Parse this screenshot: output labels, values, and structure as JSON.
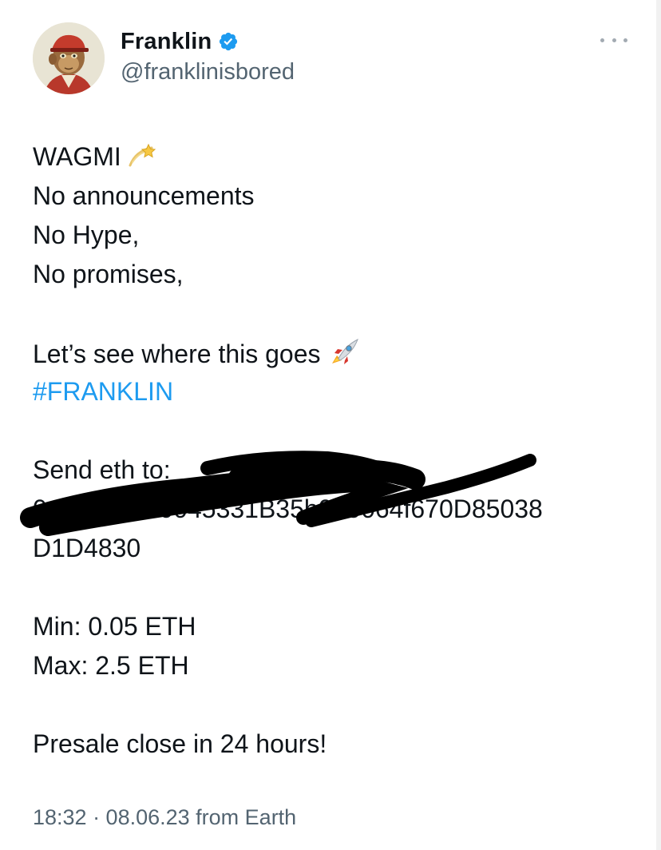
{
  "author": {
    "display_name": "Franklin",
    "handle": "@franklinisbored",
    "verified": true,
    "avatar_icon": "bored-ape-avatar"
  },
  "more_menu": {
    "icon": "more-horizontal-icon"
  },
  "tweet": {
    "lines": {
      "l1": "WAGMI",
      "l2": "No announcements",
      "l3": "No Hype,",
      "l4": "No promises,",
      "l5": "Let’s see where this goes",
      "l6": "#FRANKLIN",
      "l7": "Send eth to:",
      "l8": "0x2b010000045331B35b000064f670D85038",
      "l9": "D1D4830",
      "l10": "Min: 0.05 ETH",
      "l11": "Max: 2.5 ETH",
      "l12": "Presale close in 24 hours!"
    },
    "emoji": {
      "after_l1": "dizzy-star-emoji",
      "after_l5": "rocket-emoji"
    }
  },
  "meta": "18:32 · 08.06.23 from Earth",
  "colors": {
    "link": "#1d9bf0",
    "secondary_text": "#536471",
    "verified_badge": "#1d9bf0"
  }
}
